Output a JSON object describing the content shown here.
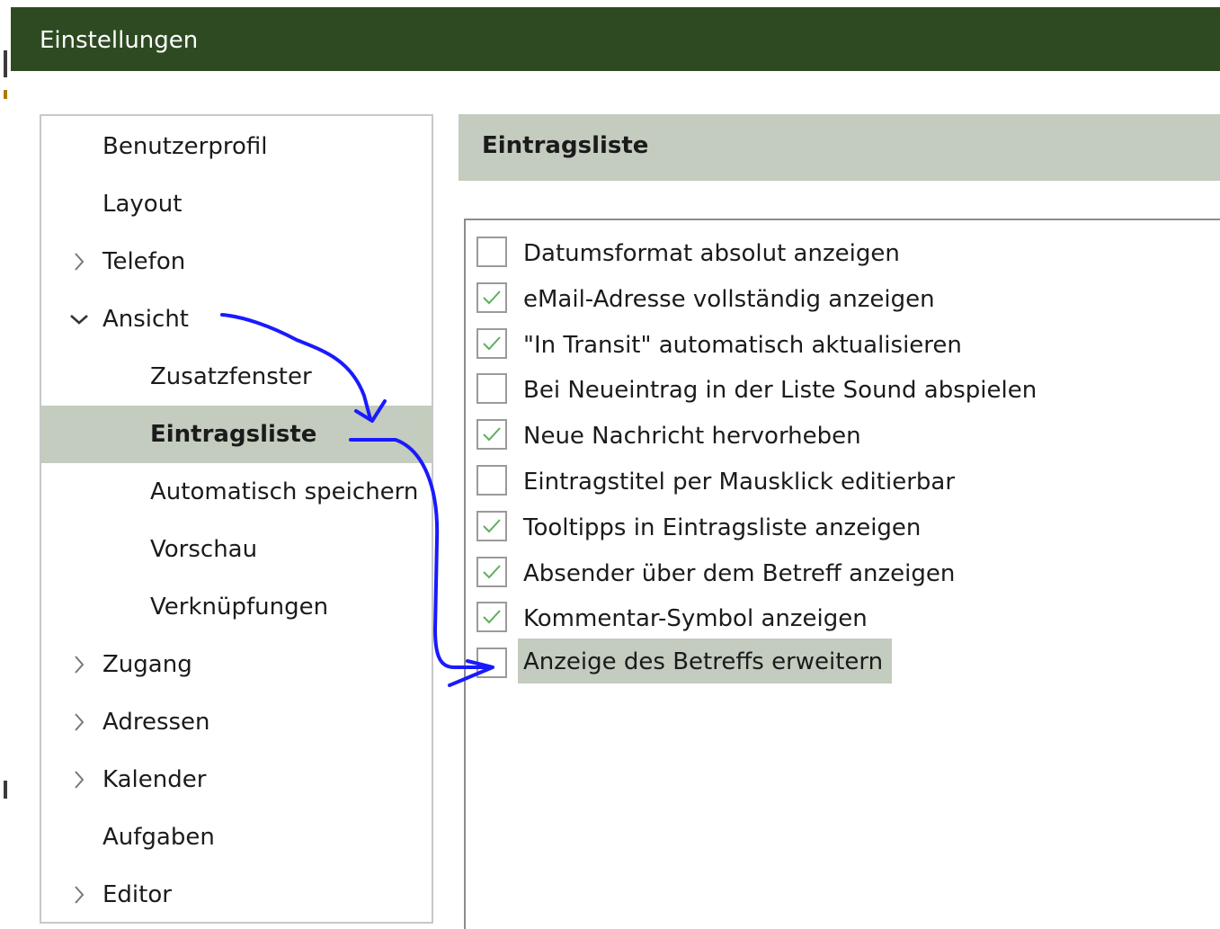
{
  "window": {
    "title": "Einstellungen"
  },
  "nav": {
    "items": [
      {
        "label": "Benutzerprofil",
        "level": 1,
        "expander": "none"
      },
      {
        "label": "Layout",
        "level": 1,
        "expander": "none"
      },
      {
        "label": "Telefon",
        "level": 1,
        "expander": "collapsed"
      },
      {
        "label": "Ansicht",
        "level": 1,
        "expander": "expanded"
      },
      {
        "label": "Zusatzfenster",
        "level": 2,
        "expander": "none"
      },
      {
        "label": "Eintragsliste",
        "level": 2,
        "expander": "none",
        "selected": true
      },
      {
        "label": "Automatisch speichern",
        "level": 2,
        "expander": "none"
      },
      {
        "label": "Vorschau",
        "level": 2,
        "expander": "none"
      },
      {
        "label": "Verknüpfungen",
        "level": 2,
        "expander": "none"
      },
      {
        "label": "Zugang",
        "level": 1,
        "expander": "collapsed"
      },
      {
        "label": "Adressen",
        "level": 1,
        "expander": "collapsed"
      },
      {
        "label": "Kalender",
        "level": 1,
        "expander": "collapsed"
      },
      {
        "label": "Aufgaben",
        "level": 1,
        "expander": "none"
      },
      {
        "label": "Editor",
        "level": 1,
        "expander": "collapsed"
      }
    ]
  },
  "section": {
    "title": "Eintragsliste"
  },
  "options": [
    {
      "label": "Datumsformat absolut anzeigen",
      "checked": false
    },
    {
      "label": "eMail-Adresse vollständig anzeigen",
      "checked": true
    },
    {
      "label": "\"In Transit\" automatisch aktualisieren",
      "checked": true
    },
    {
      "label": "Bei Neueintrag in der Liste Sound abspielen",
      "checked": false
    },
    {
      "label": "Neue Nachricht hervorheben",
      "checked": true
    },
    {
      "label": "Eintragstitel per Mausklick editierbar",
      "checked": false
    },
    {
      "label": "Tooltipps in Eintragsliste anzeigen",
      "checked": true
    },
    {
      "label": "Absender über dem Betreff anzeigen",
      "checked": true
    },
    {
      "label": "Kommentar-Symbol anzeigen",
      "checked": true
    },
    {
      "label": "Anzeige des Betreffs erweitern",
      "checked": false,
      "focused": true
    }
  ],
  "colors": {
    "titlebar": "#2e4a22",
    "selection": "#c3ccbe",
    "checkmark": "#5fae5f",
    "annotation": "#1a1aff"
  },
  "icons": {
    "collapsed": "chevron-right-icon",
    "expanded": "chevron-down-icon",
    "check": "checkmark-icon"
  }
}
